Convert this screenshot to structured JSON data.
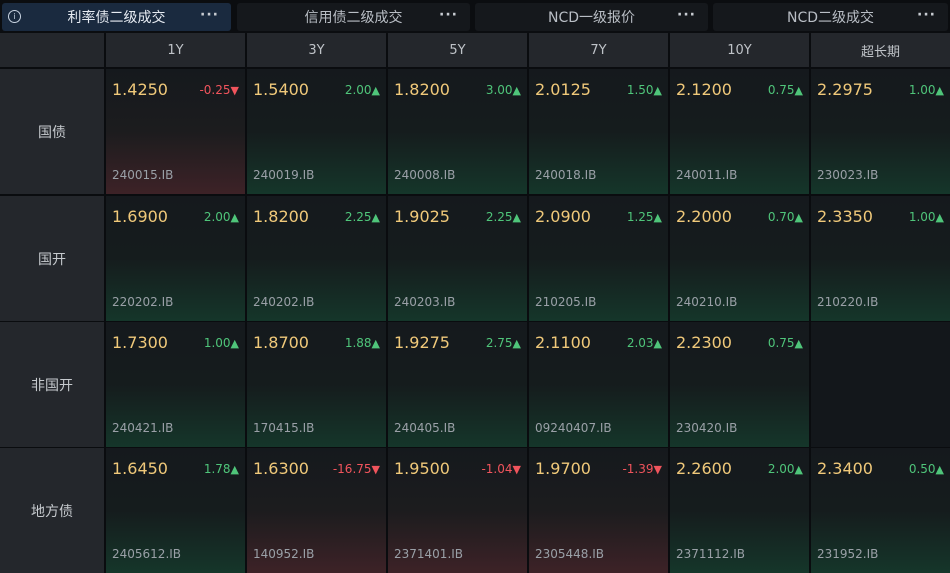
{
  "tabs": [
    {
      "label": "利率债二级成交",
      "active": true
    },
    {
      "label": "信用债二级成交",
      "active": false
    },
    {
      "label": "NCD一级报价",
      "active": false
    },
    {
      "label": "NCD二级成交",
      "active": false
    }
  ],
  "more_glyph": "···",
  "info_glyph": "i",
  "columns": [
    "1Y",
    "3Y",
    "5Y",
    "7Y",
    "10Y",
    "超长期"
  ],
  "rows": [
    {
      "label": "国债",
      "cells": [
        {
          "price": "1.4250",
          "change": "-0.25",
          "dir": "down",
          "code": "240015.IB"
        },
        {
          "price": "1.5400",
          "change": "2.00",
          "dir": "up",
          "code": "240019.IB"
        },
        {
          "price": "1.8200",
          "change": "3.00",
          "dir": "up",
          "code": "240008.IB"
        },
        {
          "price": "2.0125",
          "change": "1.50",
          "dir": "up",
          "code": "240018.IB"
        },
        {
          "price": "2.1200",
          "change": "0.75",
          "dir": "up",
          "code": "240011.IB"
        },
        {
          "price": "2.2975",
          "change": "1.00",
          "dir": "up",
          "code": "230023.IB"
        }
      ]
    },
    {
      "label": "国开",
      "cells": [
        {
          "price": "1.6900",
          "change": "2.00",
          "dir": "up",
          "code": "220202.IB"
        },
        {
          "price": "1.8200",
          "change": "2.25",
          "dir": "up",
          "code": "240202.IB"
        },
        {
          "price": "1.9025",
          "change": "2.25",
          "dir": "up",
          "code": "240203.IB"
        },
        {
          "price": "2.0900",
          "change": "1.25",
          "dir": "up",
          "code": "210205.IB"
        },
        {
          "price": "2.2000",
          "change": "0.70",
          "dir": "up",
          "code": "240210.IB"
        },
        {
          "price": "2.3350",
          "change": "1.00",
          "dir": "up",
          "code": "210220.IB"
        }
      ]
    },
    {
      "label": "非国开",
      "cells": [
        {
          "price": "1.7300",
          "change": "1.00",
          "dir": "up",
          "code": "240421.IB"
        },
        {
          "price": "1.8700",
          "change": "1.88",
          "dir": "up",
          "code": "170415.IB"
        },
        {
          "price": "1.9275",
          "change": "2.75",
          "dir": "up",
          "code": "240405.IB"
        },
        {
          "price": "2.1100",
          "change": "2.03",
          "dir": "up",
          "code": "09240407.IB"
        },
        {
          "price": "2.2300",
          "change": "0.75",
          "dir": "up",
          "code": "230420.IB"
        },
        null
      ]
    },
    {
      "label": "地方债",
      "cells": [
        {
          "price": "1.6450",
          "change": "1.78",
          "dir": "up",
          "code": "2405612.IB"
        },
        {
          "price": "1.6300",
          "change": "-16.75",
          "dir": "down",
          "code": "140952.IB"
        },
        {
          "price": "1.9500",
          "change": "-1.04",
          "dir": "down",
          "code": "2371401.IB"
        },
        {
          "price": "1.9700",
          "change": "-1.39",
          "dir": "down",
          "code": "2305448.IB"
        },
        {
          "price": "2.2600",
          "change": "2.00",
          "dir": "up",
          "code": "2371112.IB"
        },
        {
          "price": "2.3400",
          "change": "0.50",
          "dir": "up",
          "code": "231952.IB"
        }
      ]
    }
  ]
}
